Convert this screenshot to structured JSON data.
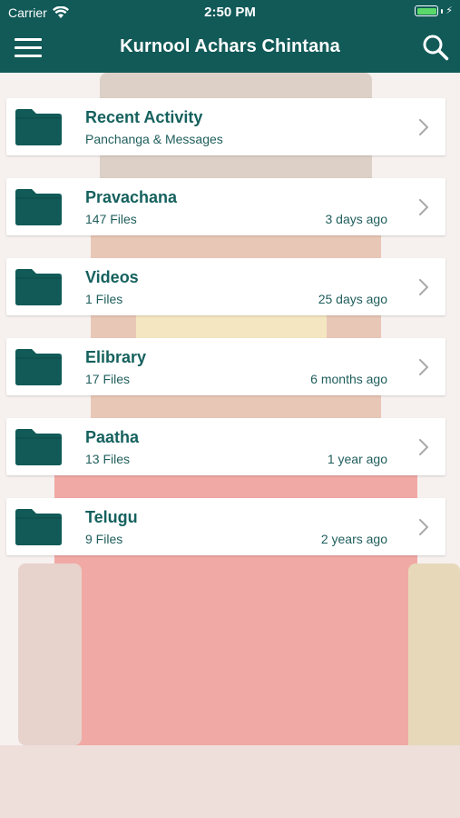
{
  "status_bar": {
    "carrier": "Carrier",
    "time": "2:50 PM",
    "battery_level": 1.0
  },
  "header": {
    "title": "Kurnool Achars Chintana"
  },
  "folders": [
    {
      "title": "Recent Activity",
      "subtitle": "Panchanga & Messages",
      "meta": ""
    },
    {
      "title": "Pravachana",
      "subtitle": "147 Files",
      "meta": "3 days ago"
    },
    {
      "title": "Videos",
      "subtitle": "1 Files",
      "meta": "25 days ago"
    },
    {
      "title": "Elibrary",
      "subtitle": "17 Files",
      "meta": "6 months ago"
    },
    {
      "title": "Paatha",
      "subtitle": "13 Files",
      "meta": "1 year ago"
    },
    {
      "title": "Telugu",
      "subtitle": "9 Files",
      "meta": "2 years ago"
    }
  ],
  "colors": {
    "header_bg": "#115a58",
    "folder_icon": "#115a58",
    "title_text": "#15615e",
    "battery": "#5ad96a"
  },
  "icons": {
    "menu": "hamburger-menu-icon",
    "search": "search-icon",
    "folder": "folder-icon",
    "chevron": "chevron-right-icon",
    "wifi": "wifi-icon",
    "battery": "battery-icon"
  }
}
